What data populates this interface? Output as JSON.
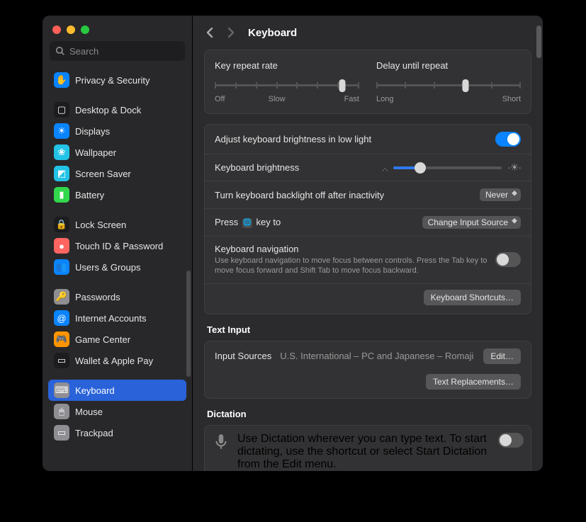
{
  "search": {
    "placeholder": "Search"
  },
  "sidebar": {
    "groups": [
      [
        {
          "label": "Privacy & Security",
          "bg": "#0a84ff",
          "glyph": "✋"
        }
      ],
      [
        {
          "label": "Desktop & Dock",
          "bg": "#1c1c1e",
          "glyph": "▢"
        },
        {
          "label": "Displays",
          "bg": "#0a84ff",
          "glyph": "☀"
        },
        {
          "label": "Wallpaper",
          "bg": "#22c3e6",
          "glyph": "❀"
        },
        {
          "label": "Screen Saver",
          "bg": "#22c3e6",
          "glyph": "◩"
        },
        {
          "label": "Battery",
          "bg": "#32d74b",
          "glyph": "▮"
        }
      ],
      [
        {
          "label": "Lock Screen",
          "bg": "#1c1c1e",
          "glyph": "🔒"
        },
        {
          "label": "Touch ID & Password",
          "bg": "#ff6560",
          "glyph": "●"
        },
        {
          "label": "Users & Groups",
          "bg": "#0a84ff",
          "glyph": "👥"
        }
      ],
      [
        {
          "label": "Passwords",
          "bg": "#8e8e93",
          "glyph": "🔑"
        },
        {
          "label": "Internet Accounts",
          "bg": "#0a84ff",
          "glyph": "@"
        },
        {
          "label": "Game Center",
          "bg": "#ff9500",
          "glyph": "🎮"
        },
        {
          "label": "Wallet & Apple Pay",
          "bg": "#1c1c1e",
          "glyph": "▭"
        }
      ],
      [
        {
          "label": "Keyboard",
          "bg": "#8e8e93",
          "glyph": "⌨"
        },
        {
          "label": "Mouse",
          "bg": "#8e8e93",
          "glyph": "🖱"
        },
        {
          "label": "Trackpad",
          "bg": "#8e8e93",
          "glyph": "▭"
        }
      ]
    ]
  },
  "header": {
    "title": "Keyboard"
  },
  "repeat": {
    "rate_label": "Key repeat rate",
    "rate_off": "Off",
    "rate_slow": "Slow",
    "rate_fast": "Fast",
    "delay_label": "Delay until repeat",
    "delay_long": "Long",
    "delay_short": "Short"
  },
  "brightness": {
    "auto_label": "Adjust keyboard brightness in low light",
    "slider_label": "Keyboard brightness",
    "backlight_label": "Turn keyboard backlight off after inactivity",
    "backlight_value": "Never",
    "globe_prefix": "Press",
    "globe_suffix": "key to",
    "globe_value": "Change Input Source",
    "nav_label": "Keyboard navigation",
    "nav_desc": "Use keyboard navigation to move focus between controls. Press the Tab key to move focus forward and Shift Tab to move focus backward.",
    "shortcuts_btn": "Keyboard Shortcuts…"
  },
  "text_input": {
    "heading": "Text Input",
    "sources_label": "Input Sources",
    "sources_value": "U.S. International – PC and Japanese – Romaji",
    "edit_btn": "Edit…",
    "replace_btn": "Text Replacements…"
  },
  "dictation": {
    "heading": "Dictation",
    "desc": "Use Dictation wherever you can type text. To start dictating, use the shortcut or select Start Dictation from the Edit menu."
  }
}
